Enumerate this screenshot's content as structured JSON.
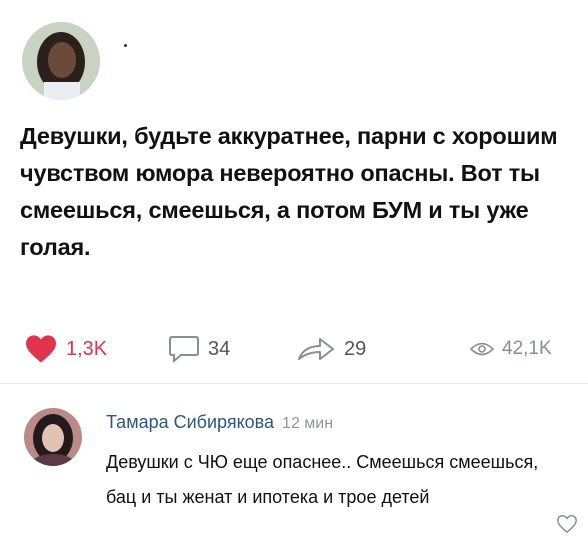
{
  "post": {
    "text": "Девушки, будьте аккуратнее, парни с хорошим чувством юмора невероятно опасны. Вот ты смеешься, смеешься, а потом БУМ и ты уже голая.",
    "likes": "1,3K",
    "comments": "34",
    "shares": "29",
    "views": "42,1K"
  },
  "comment": {
    "author": "Тамара Сибирякова",
    "time": "12 мин",
    "text": "Девушки с ЧЮ еще опаснее.. Смеешься смеешься, бац и ты женат и ипотека и трое детей"
  },
  "colors": {
    "like_accent": "#e0334d",
    "author_link": "#2a5885",
    "muted": "#939699"
  },
  "icons": [
    "heart-icon",
    "comment-icon",
    "share-icon",
    "eye-icon",
    "heart-outline-icon"
  ]
}
